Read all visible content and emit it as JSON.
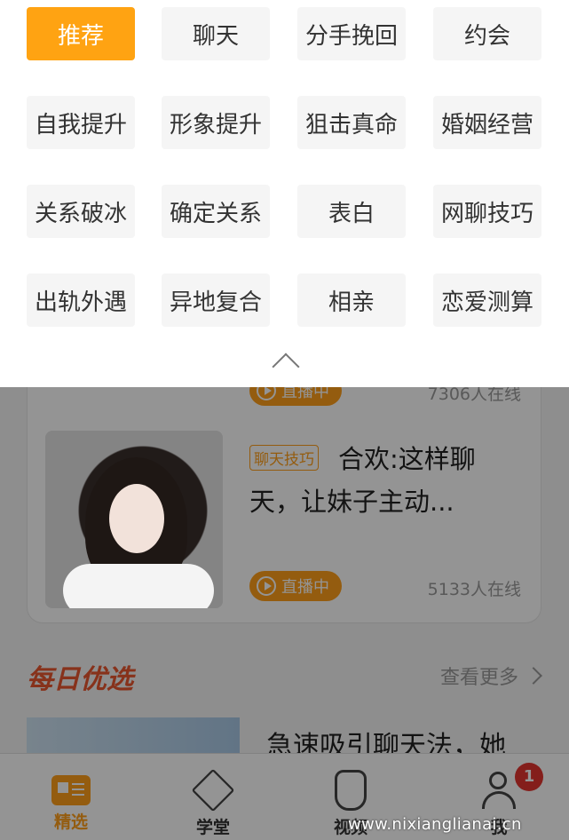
{
  "categories": [
    {
      "label": "推荐",
      "active": true
    },
    {
      "label": "聊天",
      "active": false
    },
    {
      "label": "分手挽回",
      "active": false
    },
    {
      "label": "约会",
      "active": false
    },
    {
      "label": "自我提升",
      "active": false
    },
    {
      "label": "形象提升",
      "active": false
    },
    {
      "label": "狙击真命",
      "active": false
    },
    {
      "label": "婚姻经营",
      "active": false
    },
    {
      "label": "关系破冰",
      "active": false
    },
    {
      "label": "确定关系",
      "active": false
    },
    {
      "label": "表白",
      "active": false
    },
    {
      "label": "网聊技巧",
      "active": false
    },
    {
      "label": "出轨外遇",
      "active": false
    },
    {
      "label": "异地复合",
      "active": false
    },
    {
      "label": "相亲",
      "active": false
    },
    {
      "label": "恋爱测算",
      "active": false
    }
  ],
  "colors": {
    "accent": "#ffa312",
    "section_title": "#e8562f",
    "badge": "#e3342f"
  },
  "live_card": {
    "prev_item": {
      "status": "直播中",
      "viewers": "7306人在线"
    },
    "item": {
      "tag": "聊天技巧",
      "title": "合欢:这样聊天，让妹子主动...",
      "status": "直播中",
      "viewers": "5133人在线"
    }
  },
  "daily": {
    "section_title": "每日优选",
    "more_label": "查看更多",
    "first_title": "急速吸引聊天法，她"
  },
  "tabbar": {
    "tabs": [
      {
        "label": "精选",
        "icon": "featured-icon",
        "active": true
      },
      {
        "label": "学堂",
        "icon": "academy-icon",
        "active": false
      },
      {
        "label": "视频",
        "icon": "hand-icon",
        "active": false
      },
      {
        "label": "我",
        "icon": "user-icon",
        "active": false
      }
    ],
    "badge_count": "1"
  },
  "watermark": "www.nixianglianai.cn"
}
